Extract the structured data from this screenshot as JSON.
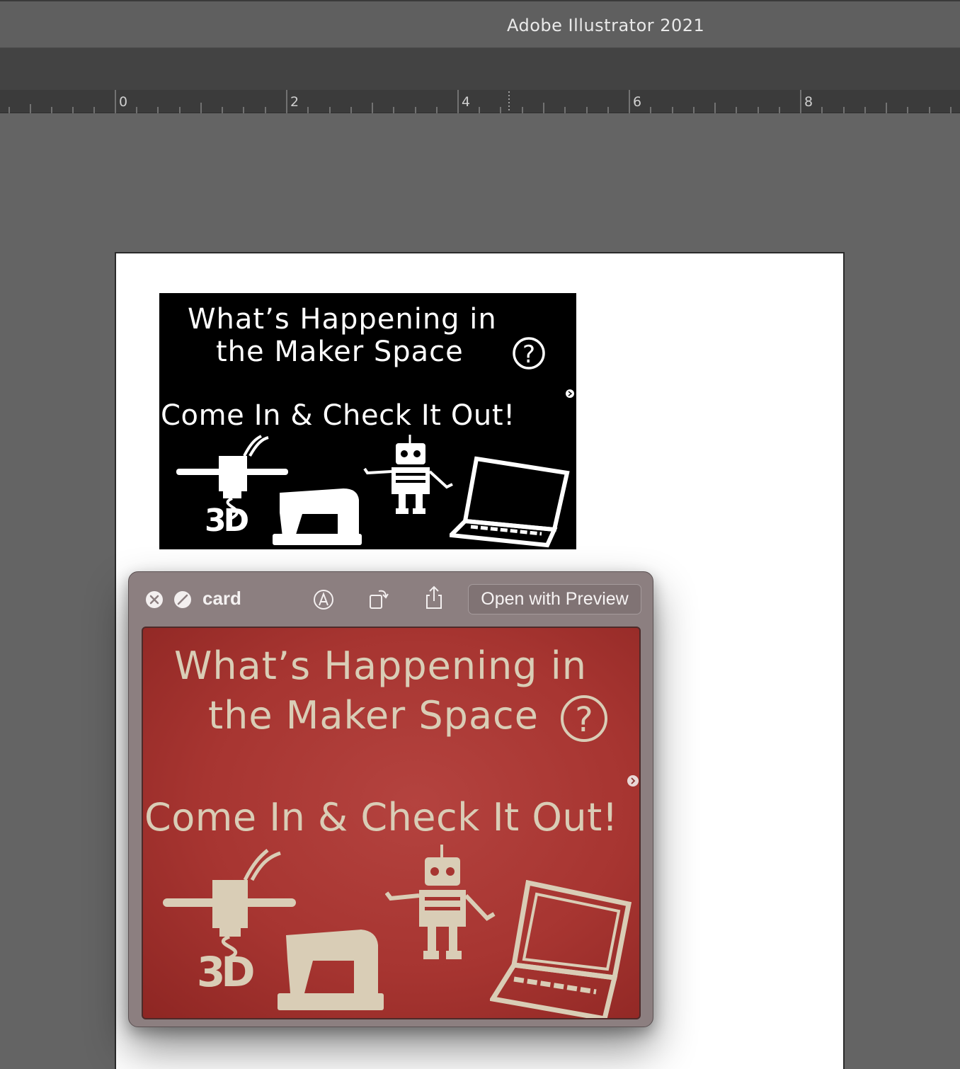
{
  "app": {
    "title": "Adobe Illustrator 2021"
  },
  "ruler": {
    "labels": [
      "0",
      "2",
      "4",
      "6",
      "8"
    ]
  },
  "artwork": {
    "line1": "What’s Happening in",
    "line2": "the Maker Space",
    "line3": "Come In & Check It Out!",
    "badge": "3D"
  },
  "quicklook": {
    "file_name": "card",
    "open_with_label": "Open with Preview",
    "icons": [
      "close-icon",
      "fullscreen-icon",
      "markup-icon",
      "rotate-icon",
      "share-icon"
    ]
  },
  "colors": {
    "card_bw": "#000000",
    "photo_red": "#a73531",
    "photo_ink": "#d9cdb6"
  }
}
